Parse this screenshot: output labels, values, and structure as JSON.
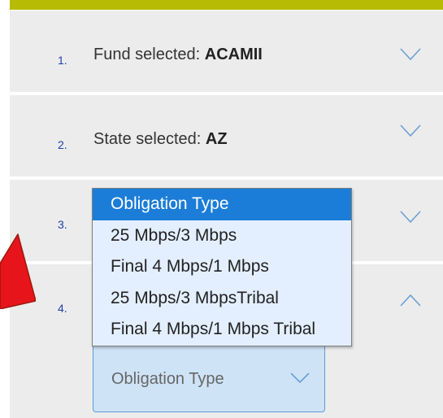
{
  "steps": [
    {
      "number": "1.",
      "label": "Fund selected: ",
      "value": "ACAMII"
    },
    {
      "number": "2.",
      "label": "State selected: ",
      "value": "AZ"
    },
    {
      "number": "3."
    },
    {
      "number": "4."
    }
  ],
  "obligation_select": {
    "value": "Obligation Type",
    "options": [
      "Obligation Type",
      "25 Mbps/3 Mbps",
      "Final 4 Mbps/1 Mbps",
      "25 Mbps/3 MbpsTribal",
      "Final 4 Mbps/1 Mbps Tribal"
    ],
    "selected_index": 0
  },
  "icons": {
    "collapsed": "chevron-down-icon",
    "expanded": "chevron-up-icon",
    "annotation": "red-arrow-icon"
  },
  "colors": {
    "accent_bar": "#b7bb04",
    "step_bg": "#ececec",
    "step_number": "#1f3fa6",
    "chevron": "#6b9fd6",
    "option_highlight": "#1b7dd7",
    "dropdown_bg": "#e3efff",
    "select_bg": "#cfe3f7",
    "annotation_arrow": "#e8141b"
  }
}
